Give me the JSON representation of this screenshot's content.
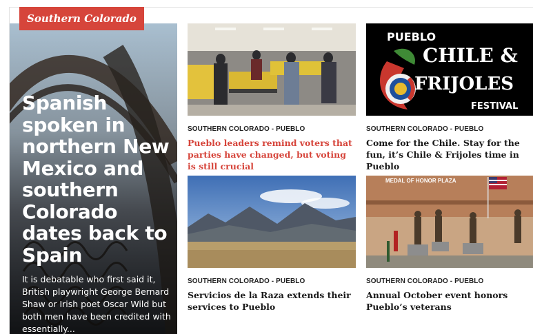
{
  "section": {
    "tag_label": "Southern Colorado"
  },
  "feature": {
    "headline": "Spanish spoken in northern New Mexico and southern Colorado dates back to Spain",
    "excerpt": "It is debatable who first said it, British playwright George Bernard Shaw or Irish poet Oscar Wild but both men have been credited with essentially..."
  },
  "cards": [
    {
      "kicker": "SOUTHERN COLORADO - PUEBLO",
      "title": "Pueblo leaders remind voters that parties have changed, but voting is still crucial",
      "image_alt": "election workers sorting ballots in a room"
    },
    {
      "kicker": "SOUTHERN COLORADO - PUEBLO",
      "title": "Come for the Chile. Stay for the fun, it’s Chile & Frijoles time in Pueblo",
      "image_alt": "festival logo",
      "logo_lines": [
        "PUEBLO",
        "CHILE &",
        "FRIJOLES",
        "FESTIVAL"
      ]
    },
    {
      "kicker": "SOUTHERN COLORADO - PUEBLO",
      "title": "Servicios de la Raza extends their services to Pueblo",
      "image_alt": "mountain landscape"
    },
    {
      "kicker": "SOUTHERN COLORADO - PUEBLO",
      "title": "Annual October event honors Pueblo’s veterans",
      "image_alt": "medal of honor plaza with statues and flags",
      "plaza_sign": "MEDAL OF HONOR PLAZA"
    }
  ],
  "colors": {
    "accent": "#d6453b"
  }
}
